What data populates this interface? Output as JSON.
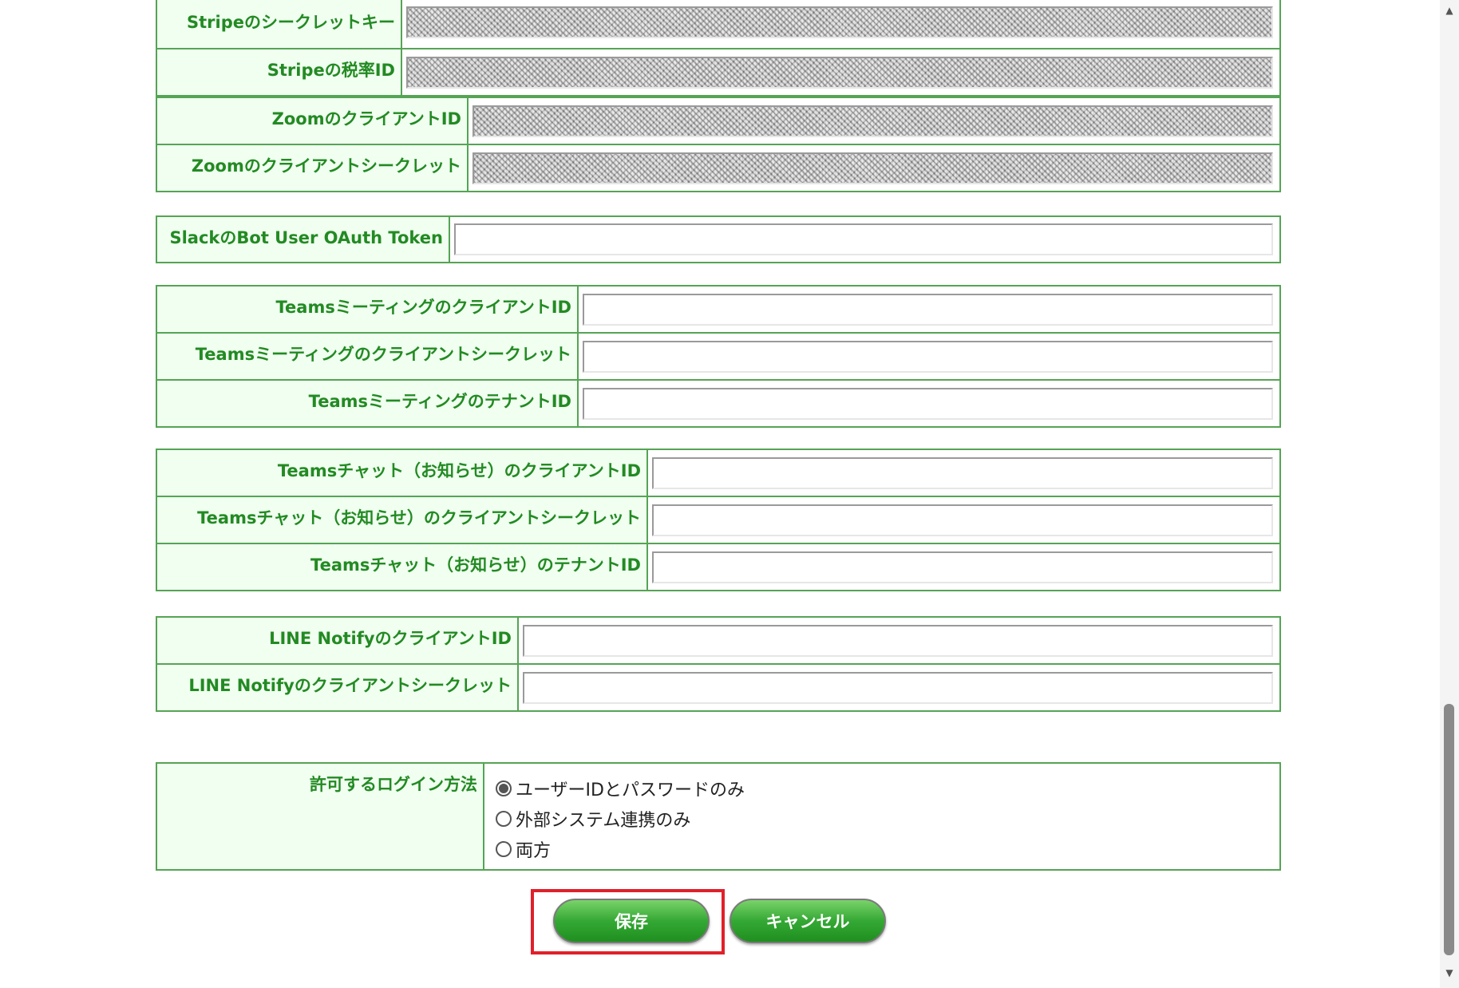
{
  "stripe": {
    "rows": [
      {
        "label": "Stripeのシークレットキー"
      },
      {
        "label": "Stripeの税率ID"
      }
    ]
  },
  "zoom": {
    "rows": [
      {
        "label": "ZoomのクライアントID"
      },
      {
        "label": "Zoomのクライアントシークレット"
      }
    ]
  },
  "slack": {
    "rows": [
      {
        "label": "SlackのBot User OAuth Token",
        "value": ""
      }
    ]
  },
  "teams_meeting": {
    "rows": [
      {
        "label": "TeamsミーティングのクライアントID",
        "value": ""
      },
      {
        "label": "Teamsミーティングのクライアントシークレット",
        "value": ""
      },
      {
        "label": "TeamsミーティングのテナントID",
        "value": ""
      }
    ]
  },
  "teams_chat": {
    "rows": [
      {
        "label": "Teamsチャット（お知らせ）のクライアントID",
        "value": ""
      },
      {
        "label": "Teamsチャット（お知らせ）のクライアントシークレット",
        "value": ""
      },
      {
        "label": "Teamsチャット（お知らせ）のテナントID",
        "value": ""
      }
    ]
  },
  "line": {
    "rows": [
      {
        "label": "LINE NotifyのクライアントID",
        "value": ""
      },
      {
        "label": "LINE Notifyのクライアントシークレット",
        "value": ""
      }
    ]
  },
  "login_method": {
    "label": "許可するログイン方法",
    "options": [
      "ユーザーIDとパスワードのみ",
      "外部システム連携のみ",
      "両方"
    ],
    "selected": "ユーザーIDとパスワードのみ"
  },
  "buttons": {
    "save": "保存",
    "cancel": "キャンセル"
  },
  "colors": {
    "label_text": "#238a23",
    "label_bg": "#f0fff0",
    "border": "#55a455",
    "button": "#34a834",
    "focus_outline": "#e0202a"
  }
}
